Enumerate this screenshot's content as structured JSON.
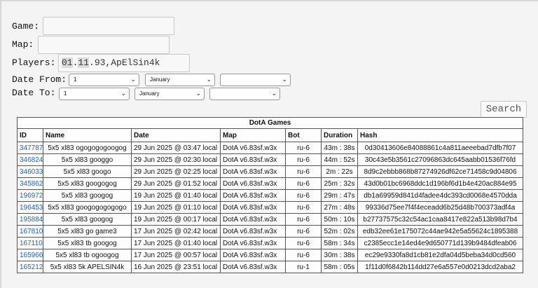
{
  "form": {
    "game_label": "Game:",
    "map_label": "Map:",
    "players_label": "Players:",
    "players_value_hl1": "01",
    "players_value_dot": ".",
    "players_value_hl2": "11",
    "players_value_rest": ".93,ApElSin4k",
    "date_from_label": "Date From:",
    "date_to_label": "Date To:",
    "from_day": "1",
    "from_month": "January",
    "from_year": "",
    "to_day": "1",
    "to_month": "January",
    "to_year": "",
    "search_label": "Search"
  },
  "table": {
    "title": "DotA Games",
    "headers": [
      "ID",
      "Name",
      "Date",
      "Map",
      "Bot",
      "Duration",
      "Hash"
    ],
    "rows": [
      [
        "347787",
        "5x5 xl83 ogogogogoogog",
        "29 Jun 2025 @ 03:47 local",
        "DotA v6.83sf.w3x",
        "ru-6",
        "43m : 38s",
        "0d30413606e84088861c4a811aeeebad7dfb7f07"
      ],
      [
        "346824",
        "5x5 xl83 googgo",
        "29 Jun 2025 @ 02:30 local",
        "DotA v6.83sf.w3x",
        "ru-6",
        "44m : 52s",
        "30c43e5b3561c27096863dc645aabb01536f76fd"
      ],
      [
        "346033",
        "5x5 xl83 googo",
        "29 Jun 2025 @ 02:25 local",
        "DotA v6.83sf.w3x",
        "ru-6",
        "2m : 22s",
        "8d9c2ebbb868b87274926df62ce71458c9d04806"
      ],
      [
        "345862",
        "5x5 xl83 googogog",
        "29 Jun 2025 @ 01:52 local",
        "DotA v6.83sf.w3x",
        "ru-6",
        "25m : 32s",
        "43d0b01bc6968ddc1d196bf6d1b4e420ac884e95"
      ],
      [
        "196972",
        "5x5 xl83 googog",
        "19 Jun 2025 @ 01:40 local",
        "DotA v6.83sf.w3x",
        "ru-6",
        "29m : 47s",
        "db1a69959d841d4fadee4dc393cd0068e4570dda"
      ],
      [
        "196453",
        "5x5 xl83 googogogogogo",
        "19 Jun 2025 @ 01:10 local",
        "DotA v6.83sf.w3x",
        "ru-6",
        "27m : 48s",
        "99336d75ee7f4f4eceadd6b25d48b700373adf4a"
      ],
      [
        "195884",
        "5x5 xl83 googog",
        "19 Jun 2025 @ 00:17 local",
        "DotA v6.83sf.w3x",
        "ru-6",
        "50m : 10s",
        "b27737575c32c54ac1caa8417e822a513b98d7b4"
      ],
      [
        "167810",
        "5x5 xl83 go game3",
        "17 Jun 2025 @ 02:42 local",
        "DotA v6.83sf.w3x",
        "ru-6",
        "52m : 02s",
        "edb32ee61e175072c44ae942e5a55624c1895388"
      ],
      [
        "167110",
        "5x5 xl83 tb googog",
        "17 Jun 2025 @ 01:40 local",
        "DotA v6.83sf.w3x",
        "ru-6",
        "58m : 34s",
        "c2385ecc1e14ed4e9d650771d139b9484dfeab06"
      ],
      [
        "165966",
        "5x5 xl83 tb ogoogog",
        "17 Jun 2025 @ 00:57 local",
        "DotA v6.83sf.w3x",
        "ru-6",
        "30m : 38s",
        "ec29e9330fa8d1cb81e2dfa04d5beba34d0cd560"
      ],
      [
        "165212",
        "5x5 xl83 5k APELSIN4k",
        "16 Jun 2025 @ 23:51 local",
        "DotA v6.83sf.w3x",
        "ru-1",
        "58m : 05s",
        "1f11d0f6842b114dd27e6a557e0d0213dcd2aba2"
      ]
    ]
  }
}
